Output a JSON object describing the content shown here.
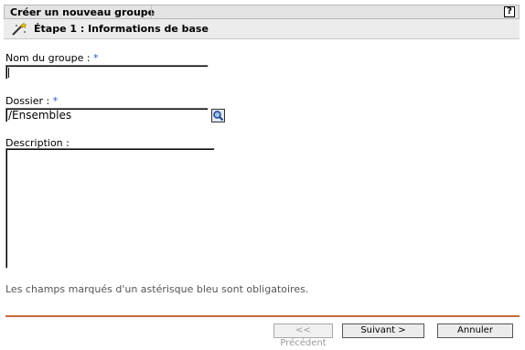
{
  "header": {
    "title": "Créer un nouveau groupe",
    "help_label": "?",
    "help_icon": "help-icon"
  },
  "step": {
    "icon": "magic-wand-icon",
    "label": "Étape 1 : Informations de base"
  },
  "form": {
    "group_name": {
      "label": "Nom du groupe : ",
      "required_marker": "*",
      "value": ""
    },
    "folder": {
      "label": "Dossier : ",
      "required_marker": "*",
      "value": "/Ensembles",
      "browse_icon": "search-icon"
    },
    "description": {
      "label": "Description :",
      "value": ""
    }
  },
  "hint": "Les champs marqués d'un astérisque bleu sont obligatoires.",
  "footer": {
    "prev_label": "<< Précédent",
    "next_label": "Suivant >",
    "cancel_label": "Annuler"
  },
  "colors": {
    "required": "#2b55c8",
    "divider": "#c86a3c"
  }
}
